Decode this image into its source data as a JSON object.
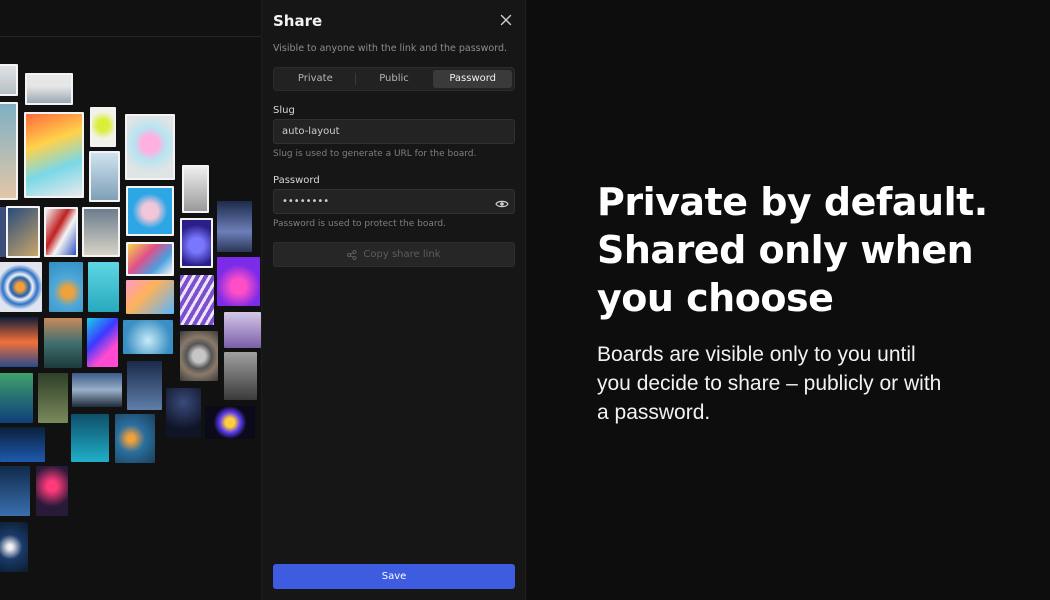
{
  "share_panel": {
    "title": "Share",
    "subtitle": "Visible to anyone with the link and the password.",
    "visibility_options": [
      "Private",
      "Public",
      "Password"
    ],
    "selected_visibility": "Password",
    "slug": {
      "label": "Slug",
      "value": "auto-layout",
      "hint": "Slug is used to generate a URL for the board."
    },
    "password": {
      "label": "Password",
      "value": "secretpw",
      "hint": "Password is used to protect the board."
    },
    "copy_link_label": "Copy share link",
    "save_label": "Save"
  },
  "hero": {
    "headline_lines": [
      "Private by default.",
      "Shared only when",
      "you choose"
    ],
    "subline_lines": [
      "Boards are visible only to you until",
      "you decide to share – publicly or with",
      "a password."
    ]
  },
  "icons": {
    "close": "close-icon",
    "eye": "eye-icon",
    "share": "share-icon"
  },
  "colors": {
    "accent": "#3d5ce0",
    "panel_bg": "#161616",
    "page_bg": "#0d0d0d"
  }
}
